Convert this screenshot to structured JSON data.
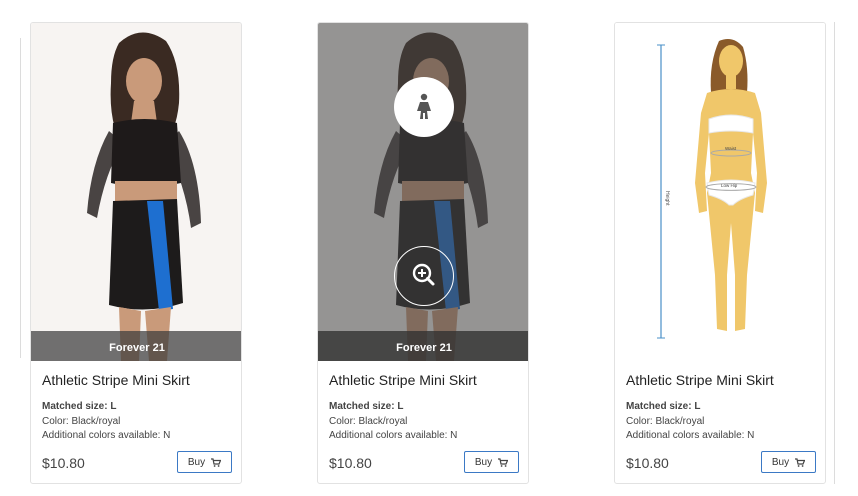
{
  "products": [
    {
      "brand": "Forever 21",
      "title": "Athletic Stripe Mini Skirt",
      "matched_label": "Matched size:",
      "matched_value": "L",
      "color_text": "Color: Black/royal",
      "additional_text": "Additional colors available: N",
      "price": "$10.80",
      "buy_label": "Buy",
      "view": "photo"
    },
    {
      "brand": "Forever 21",
      "title": "Athletic Stripe Mini Skirt",
      "matched_label": "Matched size:",
      "matched_value": "L",
      "color_text": "Color: Black/royal",
      "additional_text": "Additional colors available: N",
      "price": "$10.80",
      "buy_label": "Buy",
      "view": "photo-hover"
    },
    {
      "title": "Athletic Stripe Mini Skirt",
      "matched_label": "Matched size:",
      "matched_value": "L",
      "color_text": "Color: Black/royal",
      "additional_text": "Additional colors available: N",
      "price": "$10.80",
      "buy_label": "Buy",
      "view": "size-chart",
      "body_labels": {
        "height": "Height",
        "waist": "Waist",
        "low_hip": "Low Hip"
      }
    }
  ],
  "icons": {
    "fit": "female-figure-icon",
    "zoom": "zoom-in-icon",
    "cart": "cart-icon"
  },
  "colors": {
    "accent_border": "#3b79c5",
    "stripe": "#1e6fd0",
    "overlay": "#5a5a5a",
    "skin_chart": "#f0c76a"
  }
}
